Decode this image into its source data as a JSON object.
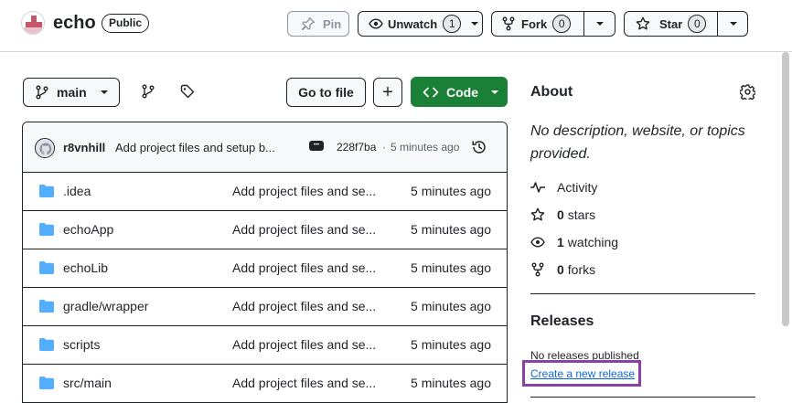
{
  "repo": {
    "name": "echo",
    "visibility": "Public"
  },
  "header_actions": {
    "pin_label": "Pin",
    "unwatch_label": "Unwatch",
    "watch_count": "1",
    "fork_label": "Fork",
    "fork_count": "0",
    "star_label": "Star",
    "star_count": "0"
  },
  "toolbar": {
    "branch": "main",
    "go_to_file": "Go to file",
    "add_label": "+",
    "code_label": "Code"
  },
  "commit": {
    "author": "r8vnhill",
    "message": "Add project files and setup b...",
    "ellipsis": "•••",
    "hash": "228f7ba",
    "separator": "·",
    "time": "5 minutes ago"
  },
  "files": [
    {
      "name": ".idea",
      "message": "Add project files and se...",
      "time": "5 minutes ago"
    },
    {
      "name": "echoApp",
      "message": "Add project files and se...",
      "time": "5 minutes ago"
    },
    {
      "name": "echoLib",
      "message": "Add project files and se...",
      "time": "5 minutes ago"
    },
    {
      "name": "gradle/wrapper",
      "message": "Add project files and se...",
      "time": "5 minutes ago"
    },
    {
      "name": "scripts",
      "message": "Add project files and se...",
      "time": "5 minutes ago"
    },
    {
      "name": "src/main",
      "message": "Add project files and se...",
      "time": "5 minutes ago"
    }
  ],
  "about": {
    "title": "About",
    "description_line1": "No description, website, or topics",
    "description_line2": "provided.",
    "activity_label": "Activity",
    "stars_count": "0",
    "stars_label": "stars",
    "watching_count": "1",
    "watching_label": "watching",
    "forks_count": "0",
    "forks_label": "forks"
  },
  "releases": {
    "title": "Releases",
    "empty_text": "No releases published",
    "create_link": "Create a new release"
  },
  "colors": {
    "accent_green": "#1a7f37",
    "folder_blue": "#54aeff",
    "highlight_purple": "#8b3fa8",
    "link_blue": "#0969da"
  }
}
